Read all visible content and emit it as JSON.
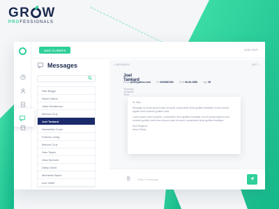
{
  "brand": {
    "main_left": "GR",
    "main_right": "W",
    "sub_accent": "PRO",
    "sub_rest": "FESSIONALS"
  },
  "colors": {
    "accent": "#2fcf9a",
    "navy": "#1b2a4e",
    "selected": "#1b2a6b"
  },
  "topbar": {
    "add_button": "ADD CLIENTS",
    "logout": "LOG OUT"
  },
  "sidebar": {
    "icons": [
      "logo-icon",
      "clock-icon",
      "users-icon",
      "document-icon",
      "chat-icon",
      "calendar-icon"
    ],
    "active": "chat-icon"
  },
  "messages": {
    "title": "Messages",
    "contacts": [
      "Rae Briggs",
      "Wynn Dalton",
      "Joliet Henderson",
      "Marcus Cruz",
      "Joel Tankard",
      "Samantha Crusu",
      "Francis Leung",
      "Marcus Cruz",
      "Sam Taylor",
      "Gina Spencer",
      "Daisy Gavin",
      "Michaela Hayes",
      "Ann Smith"
    ],
    "selected_index": 4
  },
  "conversation": {
    "back": "< MESSAGES",
    "counter": "EDIT >",
    "name": "Joel Tankard",
    "meta": {
      "email_label": "Email",
      "email": "joelt@yahoo.com",
      "phone_label": "Ph",
      "phone": "0403587426",
      "dob_label": "DOB",
      "dob": "06-06-1985",
      "age_label": "Age",
      "age": "35"
    },
    "date": "Thursday 18 March 2018",
    "card_lines": [
      "Hi Jake,",
      "Message lol lorem ipsum dolor sit amet, consectetur fenix gudiber fesetejer mi set somed eghtso  loret somedu gudiber loret.",
      "Lorem ipsum dolor sit amet, consectetur fenix gudiber fesetejer mi set somed eghtso loret somedu gudiber loret lorem ipsum dolor sit amet, consectetur fenix gudiber fesetejer.",
      "Kind Regards",
      "Anna Oshea"
    ],
    "composer_placeholder": "Write a message",
    "send_icon": "send-icon",
    "attach_icon": "paperclip-icon"
  }
}
